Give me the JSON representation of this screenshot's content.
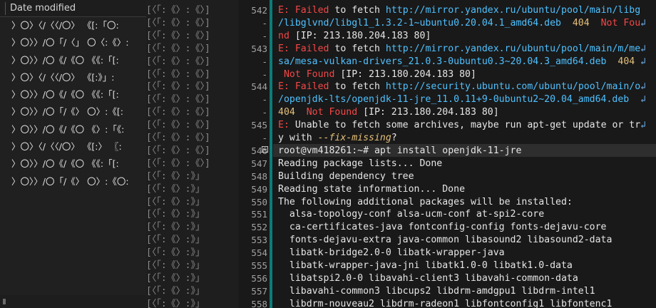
{
  "file_panel": {
    "column_header": "Date modified",
    "rows": [
      "〉〇〉〈/〈〈/〇〉 《[:「〇:",
      "〉〇〉〉/〇「/〈」 〇〈:《〉:",
      "〉〇〉〉/〇《/《〇 《《:「[:",
      "〉〇〉〈/〈〈/〇〉 《[:》」:",
      "〉〇〉〉/〇《/《〇 《《:「[:",
      "〉〇〉〉/〇「/《〉 〇〉:《[:",
      "〉〇〉〉/〇《/《〇 《〉:「《:",
      "〉〇〉〈/〈〈/〇〉 《[:〉 〖:",
      "〉〇〉〉/〇《/《〇 《《:「[:",
      "〉〇〉〉/〇「/《〉 〇〉:《〇:"
    ]
  },
  "gutter_glyphs": [
    "[〈「:《〉:《〉]",
    "[〈「:《〉:《〉]",
    "[〈「:《〉:《〉]",
    "[〈「:《〉:《〉]",
    "[〈「:《〉:《〉]",
    "[〈「:《〉:《〉]",
    "[〈「:《〉:《〉]",
    "[〈「:《〉:《〉]",
    "[〈「:《〉:《〉]",
    "[〈「:《〉:《〉]",
    "[〈「:《〉:《〉]",
    "[〈「:《〉:《〉]",
    "[〈「:《〉:《〉]",
    "[〈「:《〉:》」",
    "[〈「:《〉:》」",
    "[〈「:《〉:》」",
    "[〈「:《〉:》」",
    "[〈「:《〉:》」",
    "[〈「:《〉:》」",
    "[〈「:《〉:》」",
    "[〈「:《〉:》」",
    "[〈「:《〉:》」",
    "[〈「:《〉:》」",
    "[〈「:《〉:》」"
  ],
  "line_numbers": [
    "542",
    "-",
    "-",
    "543",
    "-",
    "-",
    "544",
    "-",
    "-",
    "545",
    "-",
    "546",
    "547",
    "548",
    "549",
    "550",
    "551",
    "552",
    "553",
    "554",
    "555",
    "556",
    "557",
    "558"
  ],
  "terminal": {
    "lines": [
      {
        "type": "err",
        "prefix": "E: ",
        "word": "Failed",
        "mid": " to fetch ",
        "url": "http://mirror.yandex.ru/ubuntu/pool/main/libg"
      },
      {
        "type": "wrapline",
        "url": "/libglvnd/libgl1_1.3.2-1~ubuntu0.20.04.1_amd64.deb",
        "tail": "  404  ",
        "nf": "Not Fou",
        "wrap": "↲"
      },
      {
        "type": "nfline",
        "nf": "nd",
        "tail": " [IP: 213.180.204.183 80]"
      },
      {
        "type": "err",
        "prefix": "E: ",
        "word": "Failed",
        "mid": " to fetch ",
        "url": "http://mirror.yandex.ru/ubuntu/pool/main/m/me",
        "wrap": "↲"
      },
      {
        "type": "wrapline",
        "url": "sa/mesa-vulkan-drivers_21.0.3-0ubuntu0.3~20.04.3_amd64.deb",
        "tail": "  404 ",
        "nf": "",
        "wrap": "↲"
      },
      {
        "type": "nfline",
        "nf": " Not Found",
        "tail": " [IP: 213.180.204.183 80]"
      },
      {
        "type": "err",
        "prefix": "E: ",
        "word": "Failed",
        "mid": " to fetch ",
        "url": "http://security.ubuntu.com/ubuntu/pool/main/o",
        "wrap": "↲"
      },
      {
        "type": "wrapline",
        "url": "/openjdk-lts/openjdk-11-jre_11.0.11+9-0ubuntu2~20.04_amd64.deb",
        "tail": "  ",
        "nf": "",
        "wrap": "↲"
      },
      {
        "type": "nfline",
        "nf": "404  Not Found",
        "tail": " [IP: 213.180.204.183 80]"
      },
      {
        "type": "plainerr",
        "prefix": "E: ",
        "text": "Unable to fetch some archives, maybe run apt-get update or tr",
        "wrap": "↲"
      },
      {
        "type": "fixline",
        "pre": "y with ",
        "opt": "--fix-missing",
        "post": "?"
      },
      {
        "type": "prompt",
        "user": "root@vm418261:~#",
        "cmd": " apt install openjdk-11-jre"
      },
      {
        "type": "plain",
        "text": "Reading package lists... Done"
      },
      {
        "type": "plain",
        "text": "Building dependency tree"
      },
      {
        "type": "plain",
        "text": "Reading state information... Done"
      },
      {
        "type": "plain",
        "text": "The following additional packages will be installed:"
      },
      {
        "type": "plain",
        "text": "  alsa-topology-conf alsa-ucm-conf at-spi2-core"
      },
      {
        "type": "plain",
        "text": "  ca-certificates-java fontconfig-config fonts-dejavu-core"
      },
      {
        "type": "plain",
        "text": "  fonts-dejavu-extra java-common libasound2 libasound2-data"
      },
      {
        "type": "plain",
        "text": "  libatk-bridge2.0-0 libatk-wrapper-java"
      },
      {
        "type": "plain",
        "text": "  libatk-wrapper-java-jni libatk1.0-0 libatk1.0-data"
      },
      {
        "type": "plain",
        "text": "  libatspi2.0-0 libavahi-client3 libavahi-common-data"
      },
      {
        "type": "plain",
        "text": "  libavahi-common3 libcups2 libdrm-amdgpu1 libdrm-intel1"
      },
      {
        "type": "plain",
        "text": "  libdrm-nouveau2 libdrm-radeon1 libfontconfig1 libfontenc1"
      }
    ]
  },
  "colors": {
    "error_red": "#f44747",
    "url_blue": "#4fc1ff",
    "change_bar": "#0d7a7a",
    "background": "#191919"
  }
}
